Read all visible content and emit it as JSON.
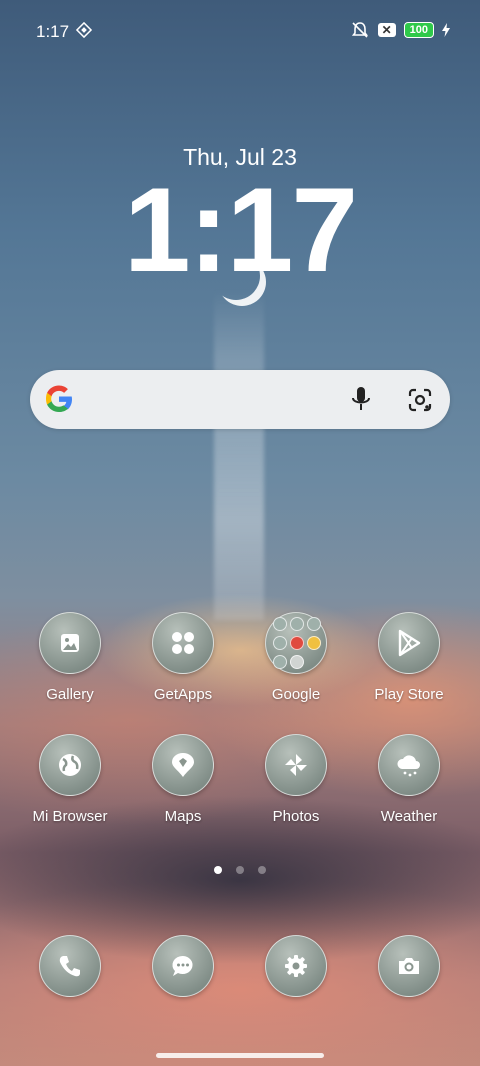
{
  "status_bar": {
    "time": "1:17",
    "battery": "100"
  },
  "lockscreen": {
    "date": "Thu, Jul 23",
    "clock": "1:17"
  },
  "search": {
    "mic_icon": "mic-icon",
    "lens_icon": "lens-icon"
  },
  "apps_row1": [
    {
      "label": "Gallery",
      "icon": "gallery-icon"
    },
    {
      "label": "GetApps",
      "icon": "grid-icon"
    },
    {
      "label": "Google",
      "icon": "folder-icon"
    },
    {
      "label": "Play Store",
      "icon": "play-icon"
    }
  ],
  "apps_row2": [
    {
      "label": "Mi Browser",
      "icon": "globe-icon"
    },
    {
      "label": "Maps",
      "icon": "map-pin-icon"
    },
    {
      "label": "Photos",
      "icon": "pinwheel-icon"
    },
    {
      "label": "Weather",
      "icon": "cloud-icon"
    }
  ],
  "dock": [
    {
      "icon": "phone-icon"
    },
    {
      "icon": "chat-icon"
    },
    {
      "icon": "gear-icon"
    },
    {
      "icon": "camera-icon"
    }
  ],
  "page_indicator": {
    "total": 3,
    "active": 1
  }
}
